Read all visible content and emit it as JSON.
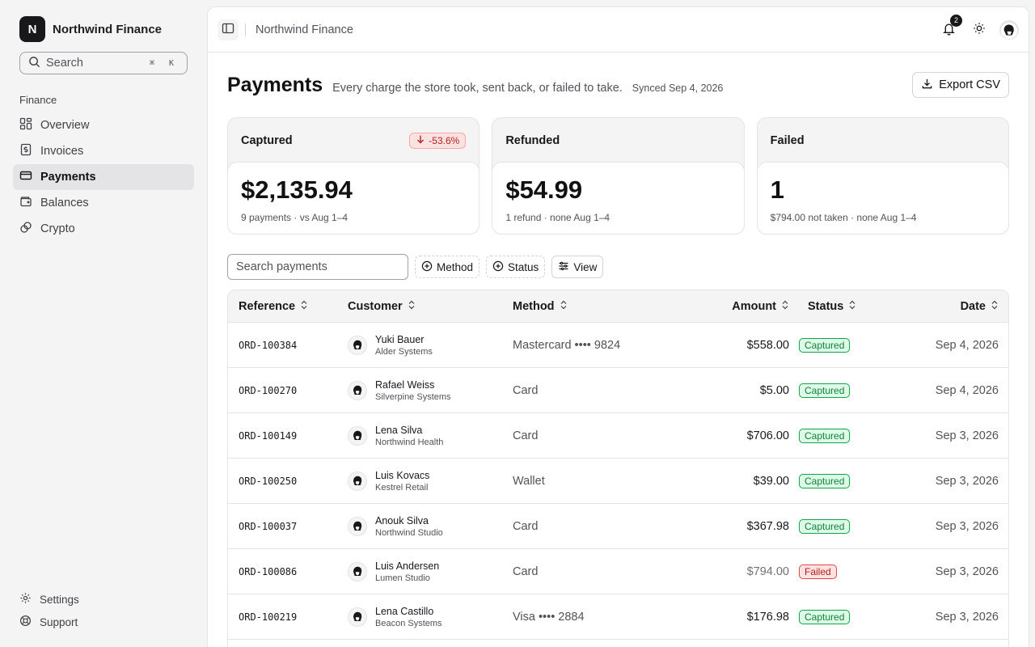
{
  "brand": {
    "logo_letter": "N",
    "name": "Northwind Finance"
  },
  "sidebar": {
    "search_placeholder": "Search",
    "search_shortcut": "⌘ K",
    "section_label": "Finance",
    "items": [
      {
        "label": "Overview",
        "icon": "grid-icon",
        "active": false
      },
      {
        "label": "Invoices",
        "icon": "invoice-icon",
        "active": false
      },
      {
        "label": "Payments",
        "icon": "credit-card-icon",
        "active": true
      },
      {
        "label": "Balances",
        "icon": "wallet-icon",
        "active": false
      },
      {
        "label": "Crypto",
        "icon": "crypto-icon",
        "active": false
      }
    ],
    "bottom_items": [
      {
        "label": "Settings",
        "icon": "gear-icon"
      },
      {
        "label": "Support",
        "icon": "lifebuoy-icon"
      }
    ]
  },
  "topbar": {
    "breadcrumb": "Northwind Finance",
    "notification_count": "2"
  },
  "page": {
    "title": "Payments",
    "subtitle": "Every charge the store took, sent back, or failed to take.",
    "synced": "Synced Sep 4, 2026",
    "export_label": "Export CSV"
  },
  "stats": [
    {
      "label": "Captured",
      "delta": "-53.6%",
      "value": "$2,135.94",
      "note": "9 payments · vs Aug 1–4"
    },
    {
      "label": "Refunded",
      "delta": "",
      "value": "$54.99",
      "note": "1 refund · none Aug 1–4"
    },
    {
      "label": "Failed",
      "delta": "",
      "value": "1",
      "note": "$794.00 not taken · none Aug 1–4"
    }
  ],
  "filters": {
    "search_placeholder": "Search payments",
    "method_label": "Method",
    "status_label": "Status",
    "view_label": "View"
  },
  "table": {
    "columns": [
      "Reference",
      "Customer",
      "Method",
      "Amount",
      "Status",
      "Date"
    ],
    "rows": [
      {
        "ref": "ORD-100384",
        "name": "Yuki Bauer",
        "company": "Alder Systems",
        "method": "Mastercard •••• 9824",
        "amount": "$558.00",
        "status": "Captured",
        "date": "Sep 4, 2026"
      },
      {
        "ref": "ORD-100270",
        "name": "Rafael Weiss",
        "company": "Silverpine Systems",
        "method": "Card",
        "amount": "$5.00",
        "status": "Captured",
        "date": "Sep 4, 2026"
      },
      {
        "ref": "ORD-100149",
        "name": "Lena Silva",
        "company": "Northwind Health",
        "method": "Card",
        "amount": "$706.00",
        "status": "Captured",
        "date": "Sep 3, 2026"
      },
      {
        "ref": "ORD-100250",
        "name": "Luis Kovacs",
        "company": "Kestrel Retail",
        "method": "Wallet",
        "amount": "$39.00",
        "status": "Captured",
        "date": "Sep 3, 2026"
      },
      {
        "ref": "ORD-100037",
        "name": "Anouk Silva",
        "company": "Northwind Studio",
        "method": "Card",
        "amount": "$367.98",
        "status": "Captured",
        "date": "Sep 3, 2026"
      },
      {
        "ref": "ORD-100086",
        "name": "Luis Andersen",
        "company": "Lumen Studio",
        "method": "Card",
        "amount": "$794.00",
        "status": "Failed",
        "date": "Sep 3, 2026"
      },
      {
        "ref": "ORD-100219",
        "name": "Lena Castillo",
        "company": "Beacon Systems",
        "method": "Visa •••• 2884",
        "amount": "$176.98",
        "status": "Captured",
        "date": "Sep 3, 2026"
      }
    ]
  },
  "colors": {
    "accent": "#18181b",
    "captured": "#15803d",
    "failed": "#b91c1c",
    "sidebar_bg": "#f4f4f5"
  }
}
